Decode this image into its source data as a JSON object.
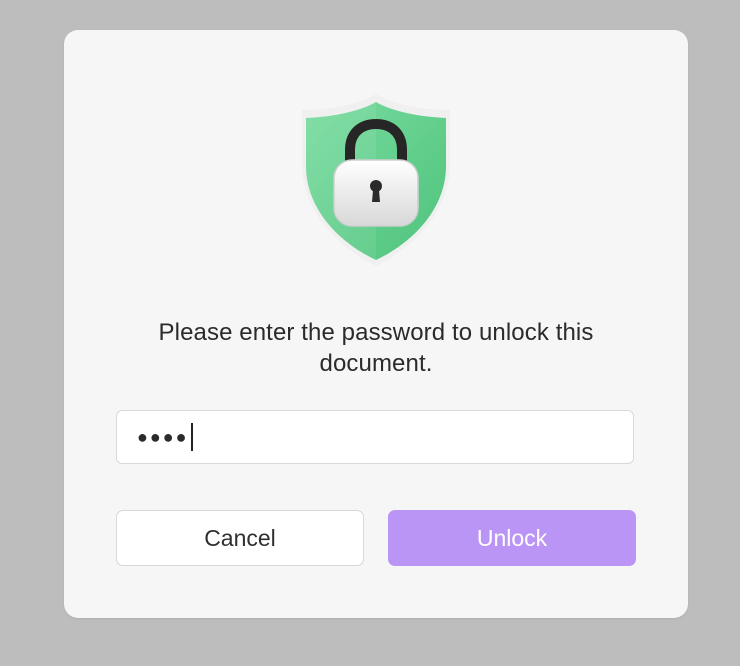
{
  "dialog": {
    "message": "Please enter the password to unlock this document.",
    "icon": "shield-lock-icon"
  },
  "password": {
    "masked_value": "●●●●",
    "length": 4
  },
  "buttons": {
    "cancel_label": "Cancel",
    "unlock_label": "Unlock"
  },
  "colors": {
    "backdrop": "#bdbdbd",
    "dialog_bg": "#f6f6f6",
    "shield_green": "#5fd08a",
    "unlock_button": "#bb95f6"
  }
}
